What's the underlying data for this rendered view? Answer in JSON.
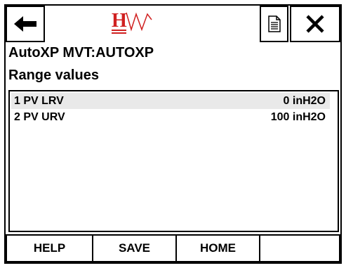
{
  "header": {
    "line1": "AutoXP MVT:AUTOXP",
    "line2": "Range values"
  },
  "toolbar": {
    "back_icon": "left-arrow-icon",
    "document_icon": "document-icon",
    "close_icon": "close-x-icon",
    "logo": "HW",
    "logo_color": "#d02020"
  },
  "rows": [
    {
      "label": "1 PV LRV",
      "value": "0 inH2O",
      "selected": true
    },
    {
      "label": "2 PV URV",
      "value": "100 inH2O",
      "selected": false
    }
  ],
  "buttons": {
    "help": "HELP",
    "save": "SAVE",
    "home": "HOME",
    "empty": ""
  }
}
